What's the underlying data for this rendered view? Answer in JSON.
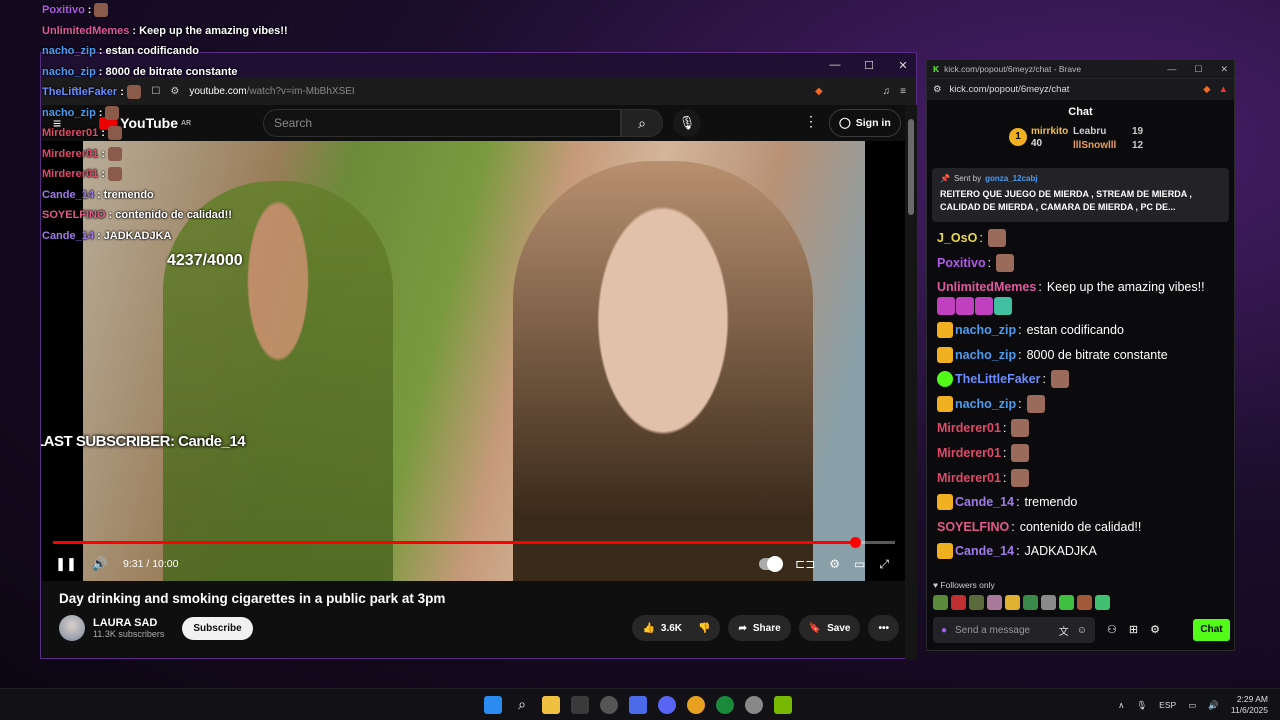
{
  "overlay_chat": [
    {
      "user": "Poxitivo",
      "color": "#b05ae8",
      "text": ""
    },
    {
      "user": "UnlimitedMemes",
      "color": "#e05aa0",
      "text": "Keep up the amazing vibes!!"
    },
    {
      "user": "nacho_zip",
      "color": "#4a9cf0",
      "text": "estan codificando"
    },
    {
      "user": "nacho_zip",
      "color": "#4a9cf0",
      "text": "8000 de bitrate constante"
    },
    {
      "user": "TheLittleFaker",
      "color": "#6a8cff",
      "text": ""
    },
    {
      "user": "nacho_zip",
      "color": "#4a9cf0",
      "text": ""
    },
    {
      "user": "Mirderer01",
      "color": "#e04a6a",
      "text": ""
    },
    {
      "user": "Mirderer01",
      "color": "#e04a6a",
      "text": ""
    },
    {
      "user": "Mirderer01",
      "color": "#e04a6a",
      "text": ""
    },
    {
      "user": "Cande_14",
      "color": "#a07ae8",
      "text": "tremendo"
    },
    {
      "user": "SOYELFINO",
      "color": "#e05a8a",
      "text": "contenido de calidad!!"
    },
    {
      "user": "Cande_14",
      "color": "#a07ae8",
      "text": "JADKADJKA"
    }
  ],
  "browser": {
    "url": "youtube.com",
    "url_path": "/watch?v=im-MbBhXSEI"
  },
  "youtube": {
    "logo": "YouTube",
    "logo_suffix": "AR",
    "search_placeholder": "Search",
    "signin": "Sign in",
    "video_title": "Day drinking and smoking cigarettes in a public park at 3pm",
    "channel_name": "LAURA SAD",
    "channel_subs": "11.3K subscribers",
    "subscribe": "Subscribe",
    "likes": "3.6K",
    "share": "Share",
    "save": "Save",
    "time": "9:31 / 10:00",
    "progress_fraction": 0.952
  },
  "stream_overlay": {
    "sub_goal": "4237/4000",
    "last_subscriber": "LAST SUBSCRIBER: Cande_14"
  },
  "kick": {
    "window_title": "kick.com/popout/6meyz/chat - Brave",
    "url": "kick.com/popout/6meyz/chat",
    "header": "Chat",
    "leaderboard": [
      {
        "name": "mirrkito",
        "count": "40"
      },
      {
        "name": "Leabru",
        "count": "19"
      },
      {
        "name": "lllSnowlll",
        "count": "12"
      }
    ],
    "rank_number": "1",
    "pinned": {
      "sent_by_label": "Sent by",
      "sender": "gonza_12cabj",
      "message": "REITERO QUE JUEGO DE MIERDA , STREAM DE MIERDA , CALIDAD DE MIERDA , CAMARA DE MIERDA , PC DE..."
    },
    "messages": [
      {
        "user": "J_OsO",
        "color": "#e8d84a",
        "text": ""
      },
      {
        "user": "Poxitivo",
        "color": "#b05ae8",
        "text": ""
      },
      {
        "user": "UnlimitedMemes",
        "color": "#e05aa0",
        "text": "Keep up the amazing vibes!!"
      },
      {
        "user": "nacho_zip",
        "color": "#4a9cf0",
        "text": "estan codificando"
      },
      {
        "user": "nacho_zip",
        "color": "#4a9cf0",
        "text": "8000 de bitrate constante"
      },
      {
        "user": "TheLittleFaker",
        "color": "#6a8cff",
        "text": ""
      },
      {
        "user": "nacho_zip",
        "color": "#4a9cf0",
        "text": ""
      },
      {
        "user": "Mirderer01",
        "color": "#e04a6a",
        "text": ""
      },
      {
        "user": "Mirderer01",
        "color": "#e04a6a",
        "text": ""
      },
      {
        "user": "Mirderer01",
        "color": "#e04a6a",
        "text": ""
      },
      {
        "user": "Cande_14",
        "color": "#a07ae8",
        "text": "tremendo"
      },
      {
        "user": "SOYELFINO",
        "color": "#e05a8a",
        "text": "contenido de calidad!!"
      },
      {
        "user": "Cande_14",
        "color": "#a07ae8",
        "text": "JADKADJKA"
      }
    ],
    "followers_only": "Followers only",
    "input_placeholder": "Send a message",
    "send_label": "Chat"
  },
  "taskbar": {
    "lang": "ESP",
    "time": "2:29 AM",
    "date": "11/6/2025"
  },
  "colors": {
    "kick_green": "#53fc18",
    "yt_red": "#ff0000",
    "window_border": "#5a2c84"
  }
}
